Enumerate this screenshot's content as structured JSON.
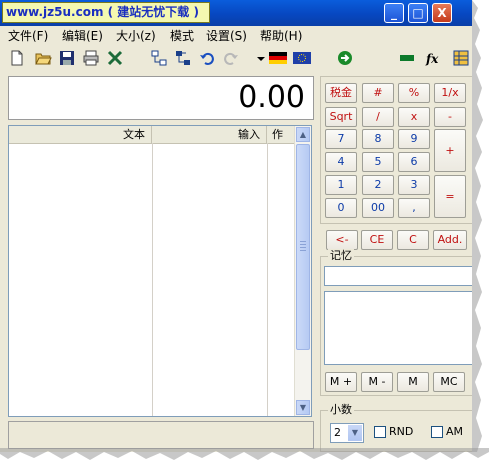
{
  "window": {
    "title": "www.jz5u.com ( 建站无忧下载 )",
    "controls": {
      "minimize": "_",
      "maximize": "□",
      "close": "X"
    }
  },
  "menu": [
    "文件(F)",
    "编辑(E)",
    "大小(z)",
    "模式",
    "设置(S)",
    "帮助(H)"
  ],
  "toolbar_icons": [
    "new-file-icon",
    "open-folder-icon",
    "save-icon",
    "print-icon",
    "excel-icon",
    "tree-icon",
    "tree-branch-icon",
    "undo-icon",
    "redo-icon",
    "dropdown-arrow-icon",
    "german-flag-icon",
    "eu-flag-icon",
    "green-circle-arrow-icon",
    "green-bar-icon",
    "fx-icon",
    "table-icon"
  ],
  "display": {
    "value": "0.00"
  },
  "tape": {
    "columns": [
      "文本",
      "输入",
      "作"
    ]
  },
  "keypad": {
    "rows": [
      [
        {
          "label": "税金",
          "style": "red"
        },
        {
          "label": "#",
          "style": "red"
        },
        {
          "label": "%",
          "style": "red"
        },
        {
          "label": "1/x",
          "style": "red"
        }
      ],
      [
        {
          "label": "Sqrt",
          "style": "red"
        },
        {
          "label": "/",
          "style": "red"
        },
        {
          "label": "x",
          "style": "red"
        },
        {
          "label": "-",
          "style": "red"
        }
      ],
      [
        {
          "label": "7"
        },
        {
          "label": "8"
        },
        {
          "label": "9"
        }
      ],
      [
        {
          "label": "4"
        },
        {
          "label": "5"
        },
        {
          "label": "6"
        }
      ],
      [
        {
          "label": "1"
        },
        {
          "label": "2"
        },
        {
          "label": "3"
        }
      ],
      [
        {
          "label": "0"
        },
        {
          "label": "00"
        },
        {
          "label": ","
        }
      ]
    ],
    "plus": "+",
    "equals": "="
  },
  "edit_keys": [
    {
      "label": "<-",
      "style": "red"
    },
    {
      "label": "CE",
      "style": "red"
    },
    {
      "label": "C",
      "style": "red"
    },
    {
      "label": "Add.",
      "style": "red"
    }
  ],
  "memory": {
    "legend": "记忆",
    "buttons": [
      "M +",
      "M -",
      "M",
      "MC"
    ]
  },
  "decimals": {
    "legend": "小数",
    "selected": "2",
    "rnd_label": "RND",
    "am_label": "AM"
  },
  "colors": {
    "title_bar": "#0a5ddc",
    "title_text_bg": "#f4f8b0",
    "window_bg": "#ece9d8",
    "key_digit": "#0e3ca8",
    "key_function": "#c01010"
  }
}
